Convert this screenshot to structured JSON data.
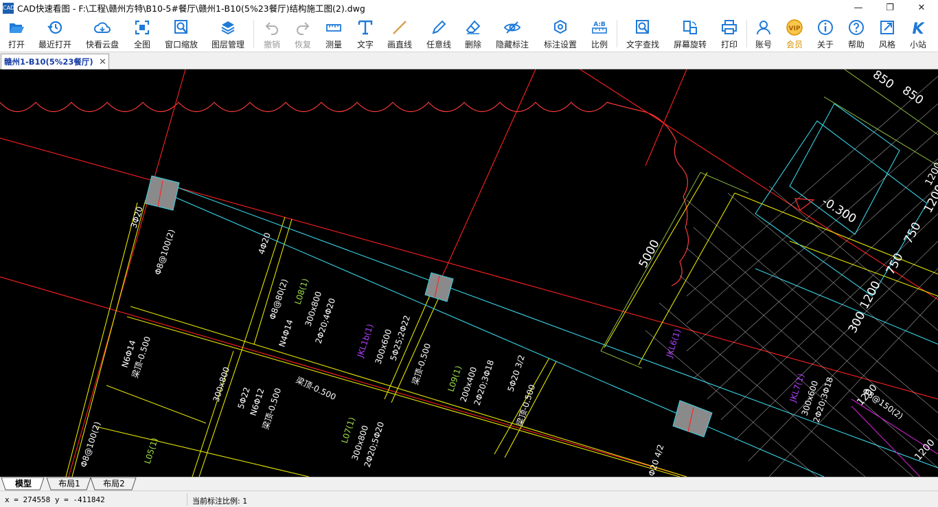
{
  "window": {
    "icon_text": "CAD",
    "title": "CAD快速看图 - F:\\工程\\赣州方特\\B10-5#餐厅\\赣州1-B10(5%23餐厅)结构施工图(2).dwg",
    "minimize": "—",
    "maximize": "❐",
    "close": "✕"
  },
  "toolbar": {
    "items": [
      {
        "label": "打开",
        "icon": "folder-open-icon"
      },
      {
        "label": "最近打开",
        "icon": "recent-clock-icon"
      },
      {
        "label": "快看云盘",
        "icon": "cloud-icon"
      },
      {
        "label": "全图",
        "icon": "fit-all-icon"
      },
      {
        "label": "窗口缩放",
        "icon": "window-zoom-icon"
      },
      {
        "label": "图层管理",
        "icon": "layers-icon"
      },
      {
        "label": "撤销",
        "icon": "undo-icon",
        "disabled": true
      },
      {
        "label": "恢复",
        "icon": "redo-icon",
        "disabled": true
      },
      {
        "label": "测量",
        "icon": "ruler-icon"
      },
      {
        "label": "文字",
        "icon": "text-t-icon"
      },
      {
        "label": "画直线",
        "icon": "line-icon"
      },
      {
        "label": "任意线",
        "icon": "pen-icon"
      },
      {
        "label": "删除",
        "icon": "eraser-icon"
      },
      {
        "label": "隐藏标注",
        "icon": "eye-hide-icon"
      },
      {
        "label": "标注设置",
        "icon": "annotation-settings-icon"
      },
      {
        "label": "比例",
        "icon": "scale-ab-icon",
        "icon_text": "A:B"
      },
      {
        "label": "文字查找",
        "icon": "text-search-icon"
      },
      {
        "label": "屏幕旋转",
        "icon": "rotate-screen-icon"
      },
      {
        "label": "打印",
        "icon": "printer-icon"
      },
      {
        "label": "账号",
        "icon": "user-icon"
      },
      {
        "label": "会员",
        "icon": "vip-icon",
        "icon_text": "VIP"
      },
      {
        "label": "关于",
        "icon": "info-icon"
      },
      {
        "label": "帮助",
        "icon": "help-icon"
      },
      {
        "label": "风格",
        "icon": "style-icon"
      },
      {
        "label": "小站",
        "icon": "site-k-icon",
        "icon_text": "K"
      }
    ]
  },
  "doc_tab": {
    "label": "赣州1-B10(5%23餐厅)",
    "close": "✕"
  },
  "drawing": {
    "dims": [
      "850",
      "850",
      "1200",
      "750",
      "750",
      "1200",
      "300",
      "5000",
      "1200",
      "1200",
      "1200",
      "-0.300"
    ],
    "beams": [
      {
        "lines": [
          "3Φ20"
        ]
      },
      {
        "lines": [
          "Φ8@100(2)"
        ]
      },
      {
        "lines": [
          "4Φ20"
        ]
      },
      {
        "lines": [
          "Φ8@80(2)"
        ]
      },
      {
        "lines": [
          "L08(1)",
          "300x800",
          "2Φ20;4Φ20",
          "N4Φ14"
        ]
      },
      {
        "lines": [
          "JKL1b(1)",
          "300x600",
          "5Φ25;2Φ22"
        ]
      },
      {
        "lines": [
          "梁顶-0.500"
        ]
      },
      {
        "lines": [
          "L09(1)",
          "200x400",
          "2Φ20;3Φ18"
        ]
      },
      {
        "lines": [
          "5Φ20 3/2"
        ]
      },
      {
        "lines": [
          "梁顶-0.500"
        ]
      },
      {
        "lines": [
          "N6Φ14",
          "梁顶-0.500"
        ]
      },
      {
        "lines": [
          "300x800"
        ]
      },
      {
        "lines": [
          "5Φ22",
          "N6Φ12",
          "梁顶-0.500"
        ]
      },
      {
        "lines": [
          "梁顶-0.500"
        ]
      },
      {
        "lines": [
          "L07(1)",
          "300x800",
          "2Φ20;5Φ20"
        ]
      },
      {
        "lines": [
          "Φ8@100(2)"
        ]
      },
      {
        "lines": [
          "L05(1)"
        ]
      },
      {
        "lines": [
          "JKL6(1)"
        ]
      },
      {
        "lines": [
          "JKL7(1)",
          "300x600",
          "2Φ20;3Φ18"
        ]
      },
      {
        "lines": [
          "Φ8@150(2)"
        ]
      },
      {
        "lines": [
          "Φ20 4/2"
        ]
      }
    ]
  },
  "layout_tabs": [
    "模型",
    "布局1",
    "布局2"
  ],
  "status": {
    "coords": "x = 274558  y = -411842",
    "scale": "当前标注比例: 1"
  }
}
